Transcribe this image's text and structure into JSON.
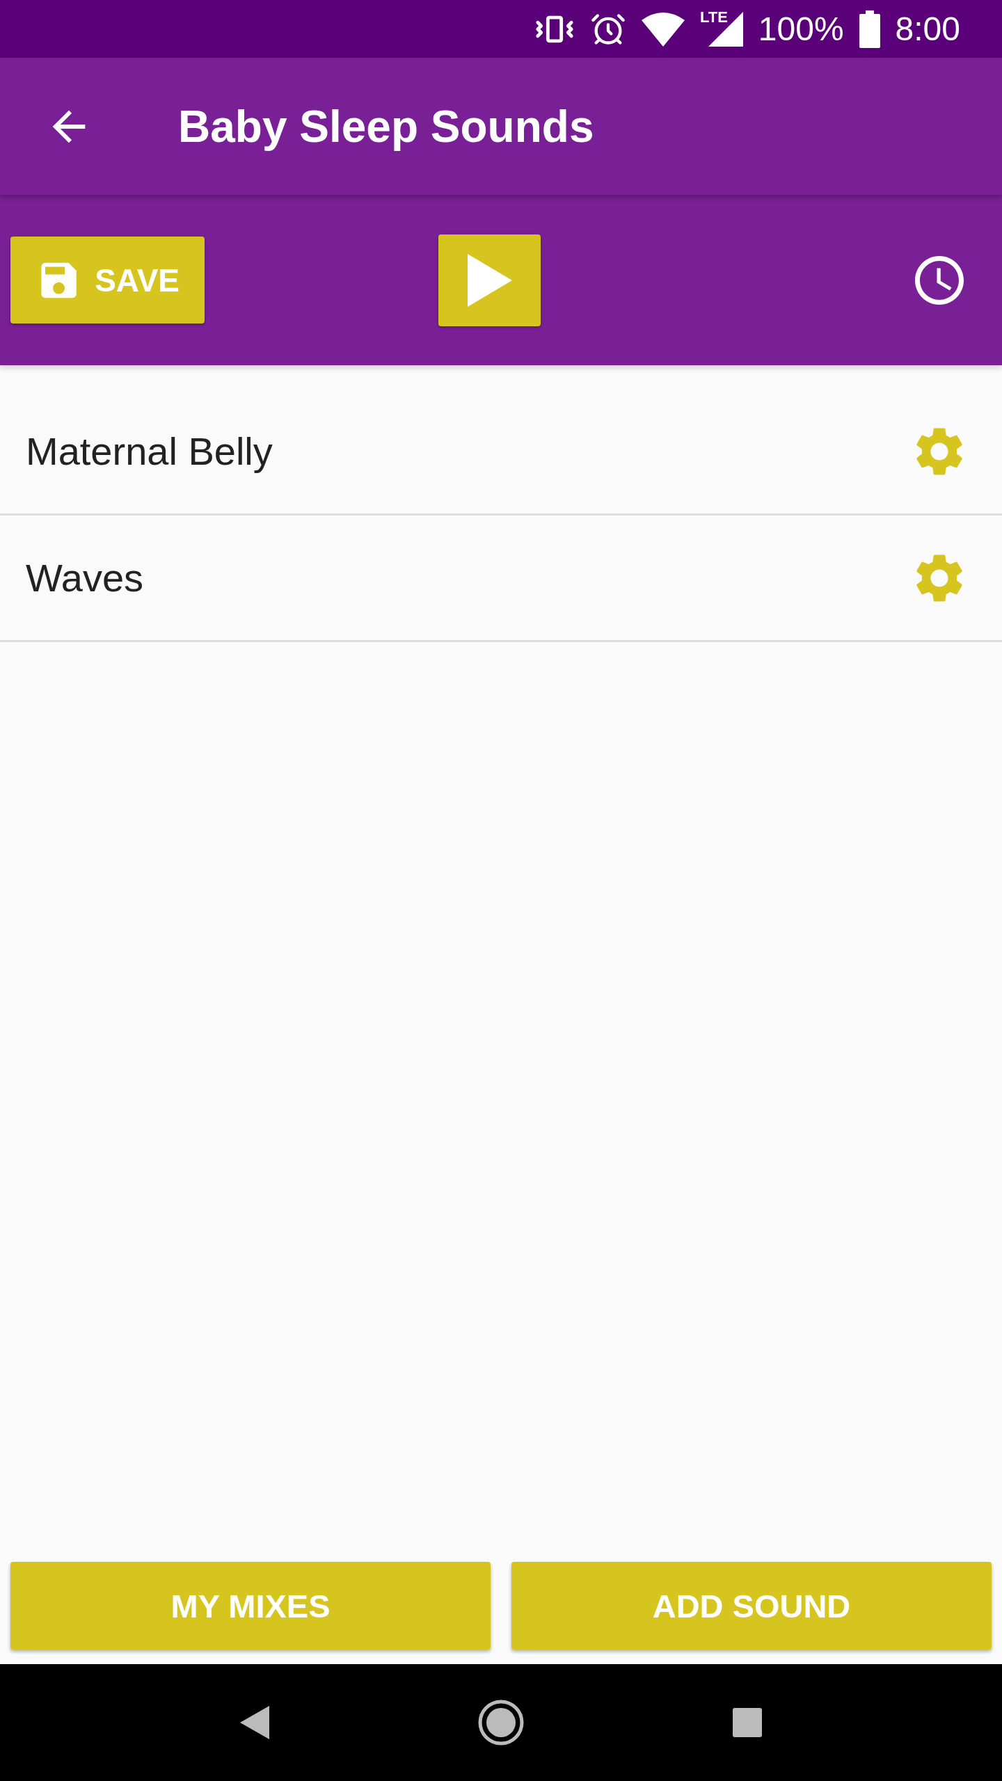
{
  "status_bar": {
    "network": "LTE",
    "battery": "100%",
    "time": "8:00"
  },
  "app_bar": {
    "title": "Baby Sleep Sounds"
  },
  "toolbar": {
    "save_label": "SAVE"
  },
  "sounds": [
    {
      "name": "Maternal Belly"
    },
    {
      "name": "Waves"
    }
  ],
  "buttons": [
    "MY MIXES",
    "ADD SOUND"
  ]
}
